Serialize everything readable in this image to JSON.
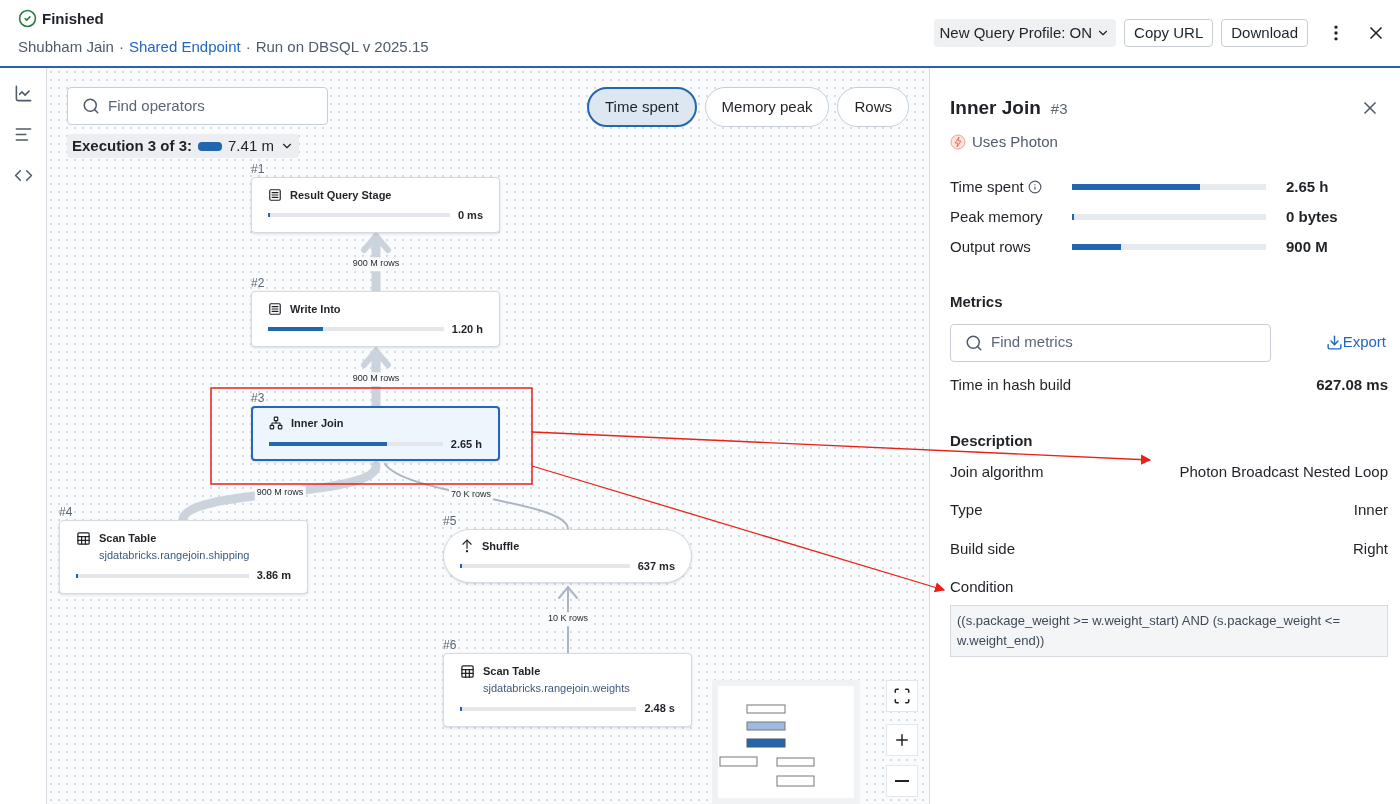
{
  "header": {
    "status": "Finished",
    "owner": "Shubham Jain",
    "separator": "·",
    "endpoint": "Shared Endpoint",
    "run": "Run on DBSQL v 2025.15",
    "actions": [
      "New Query Profile: ON",
      "Copy URL",
      "Download"
    ]
  },
  "canvas": {
    "search": {
      "placeholder": "Find operators"
    },
    "metric_tabs": [
      {
        "label": "Time spent",
        "selected": true
      },
      {
        "label": "Memory peak",
        "selected": false
      },
      {
        "label": "Rows",
        "selected": false
      }
    ],
    "execution": {
      "label": "Execution 3 of 3:",
      "value": "7.41 m"
    },
    "nodes": [
      {
        "id": "#1",
        "kind": "stage",
        "title": "Result Query Stage",
        "value": "0 ms",
        "level": 0.01,
        "selected": false
      },
      {
        "id": "#2",
        "kind": "stage",
        "title": "Write Into",
        "value": "1.20 h",
        "level": 0.31,
        "selected": false
      },
      {
        "id": "#3",
        "kind": "join",
        "title": "Inner Join",
        "value": "2.65 h",
        "level": 0.68,
        "selected": true
      },
      {
        "id": "#4",
        "kind": "scan",
        "title": "Scan Table",
        "subtitle": "sjdatabricks.rangejoin.shipping",
        "value": "3.86 m",
        "level": 0.01,
        "selected": false
      },
      {
        "id": "#5",
        "kind": "shuffle",
        "title": "Shuffle",
        "value": "637 ms",
        "level": 0.01,
        "selected": false
      },
      {
        "id": "#6",
        "kind": "scan",
        "title": "Scan Table",
        "subtitle": "sjdatabricks.rangejoin.weights",
        "value": "2.48 s",
        "level": 0.01,
        "selected": false
      }
    ],
    "edges": [
      {
        "label": "900 M rows",
        "kind": "heavy"
      },
      {
        "label": "900 M rows",
        "kind": "heavy"
      },
      {
        "label": "900 M rows",
        "kind": "heavy"
      },
      {
        "label": "70 K rows",
        "kind": "light"
      },
      {
        "label": "10 K rows",
        "kind": "light"
      }
    ]
  },
  "panel": {
    "title": "Inner Join",
    "id": "#3",
    "badge": "Uses Photon",
    "stats": [
      {
        "label": "Time spent",
        "info": true,
        "level": 0.66,
        "value": "2.65 h"
      },
      {
        "label": "Peak memory",
        "info": false,
        "level": 0.01,
        "value": "0 bytes"
      },
      {
        "label": "Output rows",
        "info": false,
        "level": 0.25,
        "value": "900 M"
      }
    ],
    "metrics": {
      "heading": "Metrics",
      "search": {
        "placeholder": "Find metrics"
      },
      "export": "Export",
      "rows": [
        {
          "label": "Time in hash build",
          "value": "627.08 ms"
        }
      ]
    },
    "description": {
      "heading": "Description",
      "rows": [
        {
          "label": "Join algorithm",
          "value": "Photon Broadcast Nested Loop"
        },
        {
          "label": "Type",
          "value": "Inner"
        },
        {
          "label": "Build side",
          "value": "Right"
        }
      ],
      "condition_label": "Condition",
      "condition": "((s.package_weight >= w.weight_start) AND (s.package_weight <= w.weight_end))"
    }
  }
}
